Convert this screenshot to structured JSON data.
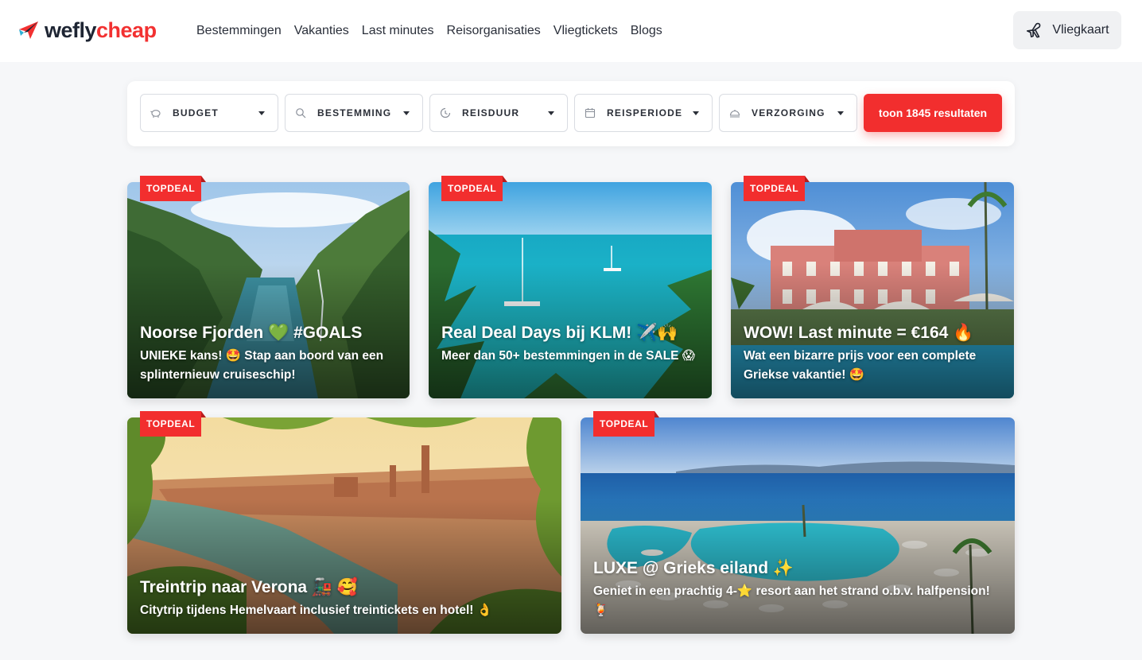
{
  "header": {
    "logo": {
      "part1": "wefly",
      "part2": "cheap"
    },
    "nav": [
      "Bestemmingen",
      "Vakanties",
      "Last minutes",
      "Reisorganisaties",
      "Vliegtickets",
      "Blogs"
    ],
    "flight_button": "Vliegkaart"
  },
  "filters": [
    {
      "label": "BUDGET",
      "icon": "piggy-bank-icon"
    },
    {
      "label": "BESTEMMING",
      "icon": "search-icon"
    },
    {
      "label": "REISDUUR",
      "icon": "clock-icon"
    },
    {
      "label": "REISPERIODE",
      "icon": "calendar-icon"
    },
    {
      "label": "VERZORGING",
      "icon": "food-icon"
    }
  ],
  "results_button": "toon 1845 resultaten",
  "colors": {
    "accent": "#f22e2e",
    "dark": "#1e2533"
  },
  "cards": [
    {
      "badge": "TOPDEAL",
      "title": "Noorse Fjorden 💚 #GOALS",
      "subtitle": "UNIEKE kans! 🤩 Stap aan boord van een splinternieuw cruiseschip!"
    },
    {
      "badge": "TOPDEAL",
      "title": "Real Deal Days bij KLM! ✈️🙌",
      "subtitle": "Meer dan 50+ bestemmingen in de SALE 😱"
    },
    {
      "badge": "TOPDEAL",
      "title": "WOW! Last minute = €164 🔥",
      "subtitle": "Wat een bizarre prijs voor een complete Griekse vakantie! 🤩"
    },
    {
      "badge": "TOPDEAL",
      "title": "Treintrip naar Verona 🚂 🥰",
      "subtitle": "Citytrip tijdens Hemelvaart inclusief treintickets en hotel! 👌"
    },
    {
      "badge": "TOPDEAL",
      "title": "LUXE @ Grieks eiland ✨",
      "subtitle": "Geniet in een prachtig 4-⭐ resort aan het strand o.b.v. halfpension! 🍹"
    }
  ]
}
